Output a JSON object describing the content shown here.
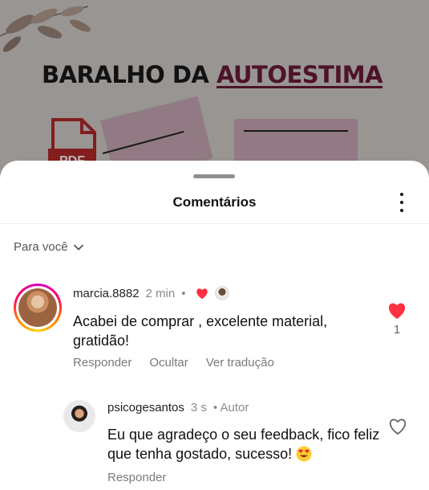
{
  "background_post": {
    "title_prefix": "BARALHO DA",
    "title_accent": "AUTOESTIMA",
    "pdf_label": "PDF"
  },
  "sheet": {
    "title": "Comentários",
    "sort_label": "Para você"
  },
  "comment": {
    "username": "marcia.8882",
    "time": "2 min",
    "dot": "•",
    "text": "Acabei de comprar , excelente material, gratidão!",
    "like_count": "1",
    "actions": {
      "reply": "Responder",
      "hide": "Ocultar",
      "translate": "Ver tradução"
    }
  },
  "reply": {
    "username": "psicogesantos",
    "time": "3 s",
    "author_label": "• Autor",
    "text": "Eu que agradeço o seu feedback, fico feliz que tenha gostado, sucesso!",
    "emoji": "heart-eyes-emoji",
    "actions": {
      "reply": "Responder"
    }
  },
  "colors": {
    "like_red": "#ff3040",
    "accent_wine": "#6b1b3a"
  }
}
